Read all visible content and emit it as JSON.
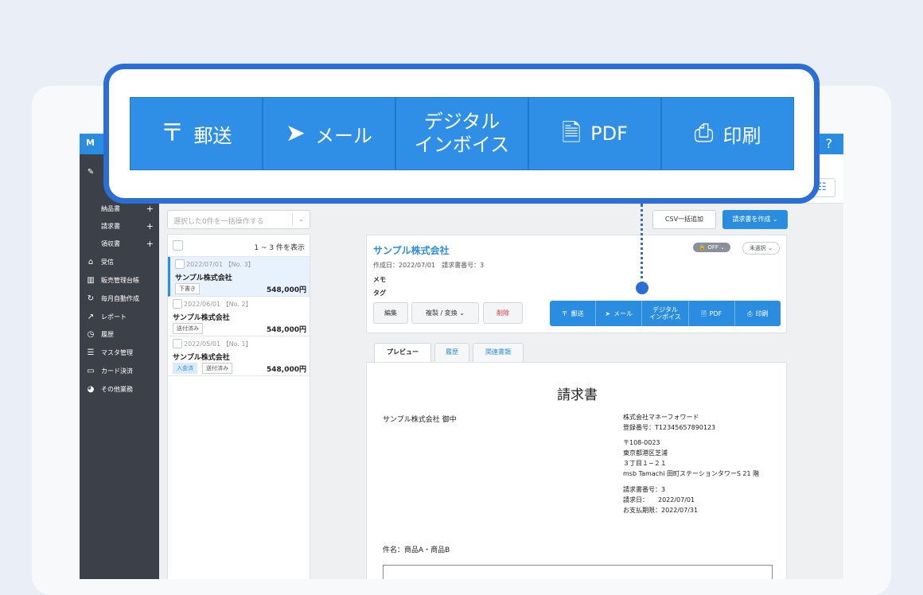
{
  "app": {
    "logo": "M",
    "help": "?"
  },
  "sidebar": {
    "sub_items": [
      {
        "label": "納品書"
      },
      {
        "label": "請求書"
      },
      {
        "label": "領収書"
      }
    ],
    "items": [
      {
        "label": "受信",
        "icon": "inbox-icon"
      },
      {
        "label": "販売管理台帳",
        "icon": "ledger-icon"
      },
      {
        "label": "毎月自動作成",
        "icon": "refresh-icon"
      },
      {
        "label": "レポート",
        "icon": "chart-icon"
      },
      {
        "label": "履歴",
        "icon": "history-icon"
      },
      {
        "label": "マスタ管理",
        "icon": "list-icon"
      },
      {
        "label": "カード決済",
        "icon": "card-icon"
      },
      {
        "label": "その他業務",
        "icon": "misc-icon"
      }
    ]
  },
  "bulk_action": {
    "placeholder": "選択した0件を一括操作する"
  },
  "list": {
    "count_label": "1 ~ 3 件を表示",
    "rows": [
      {
        "meta": "2022/07/01 【No. 3】",
        "name": "サンプル株式会社",
        "amount": "548,000円",
        "badges": [
          "下書き"
        ]
      },
      {
        "meta": "2022/06/01 【No. 2】",
        "name": "サンプル株式会社",
        "amount": "548,000円",
        "badges": [
          "送付済み"
        ]
      },
      {
        "meta": "2022/05/01 【No. 1】",
        "name": "サンプル株式会社",
        "amount": "548,000円",
        "badges": [
          "入金済",
          "送付済み"
        ]
      }
    ]
  },
  "toolbar": {
    "csv_label": "CSV一括追加",
    "create_label": "請求書を作成 ⌄"
  },
  "detail": {
    "title": "サンプル株式会社",
    "toggle": "OFF",
    "unselected": "未選択",
    "info": "作成日：2022/07/01　請求書番号：3",
    "memo": "メモ",
    "tag": "タグ",
    "edit": "編集",
    "copy": "複製 / 変換 ⌄",
    "delete": "削除"
  },
  "send_options": {
    "post": "郵送",
    "mail": "メール",
    "digital_line1": "デジタル",
    "digital_line2": "インボイス",
    "pdf": "PDF",
    "print": "印刷"
  },
  "tabs": {
    "preview": "プレビュー",
    "history": "履歴",
    "related": "関連書類"
  },
  "document": {
    "title": "請求書",
    "client": "サンプル株式会社 御中",
    "issuer_name": "株式会社マネーフォワード",
    "reg_no": "登録番号：T12345657890123",
    "postal": "〒108-0023",
    "addr1": "東京都港区芝浦",
    "addr2": "３丁目１−２１",
    "addr3": "msb Tamachi 田町ステーションタワーS 21 階",
    "invoice_no": "請求書番号：3",
    "invoice_date": "請求日：　　2022/07/01",
    "due_date": "お支払期限：2022/07/31",
    "subject": "件名：商品A・商品B"
  }
}
